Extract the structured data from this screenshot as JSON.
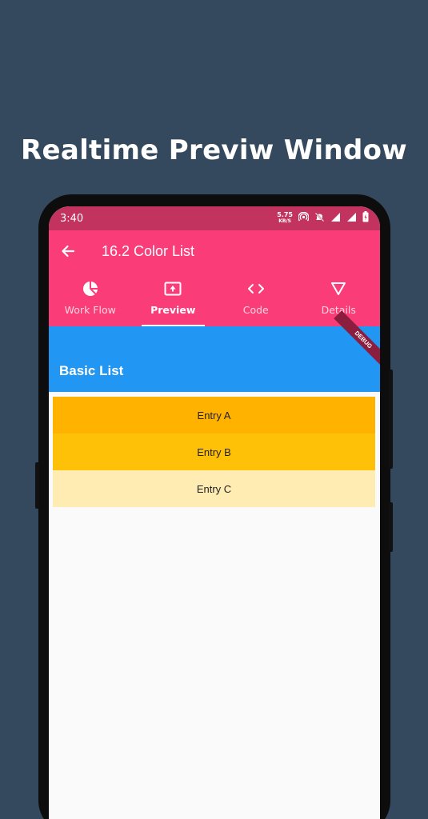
{
  "headline": "Realtime Previw Window",
  "status_bar": {
    "time": "3:40",
    "net_speed_value": "5.75",
    "net_speed_unit": "KB/S",
    "icons": [
      "hotspot-icon",
      "mute-icon",
      "wifi-icon",
      "signal-icon",
      "battery-icon"
    ]
  },
  "app_bar": {
    "title": "16.2 Color List",
    "tabs": [
      {
        "label": "Work Flow",
        "icon": "pie-chart-icon"
      },
      {
        "label": "Preview",
        "icon": "upload-screen-icon"
      },
      {
        "label": "Code",
        "icon": "code-icon"
      },
      {
        "label": "Details",
        "icon": "triangle-down-icon"
      }
    ],
    "active_tab": "Preview"
  },
  "preview": {
    "header_title": "Basic List",
    "debug_banner": "DEBUG",
    "entries": [
      {
        "label": "Entry A",
        "color": "#ffb300"
      },
      {
        "label": "Entry B",
        "color": "#ffc107"
      },
      {
        "label": "Entry C",
        "color": "#ffecb3"
      }
    ]
  },
  "colors": {
    "background": "#34495e",
    "status_bar": "#c2345f",
    "app_bar": "#fa3d78",
    "preview_header": "#2196f3"
  }
}
